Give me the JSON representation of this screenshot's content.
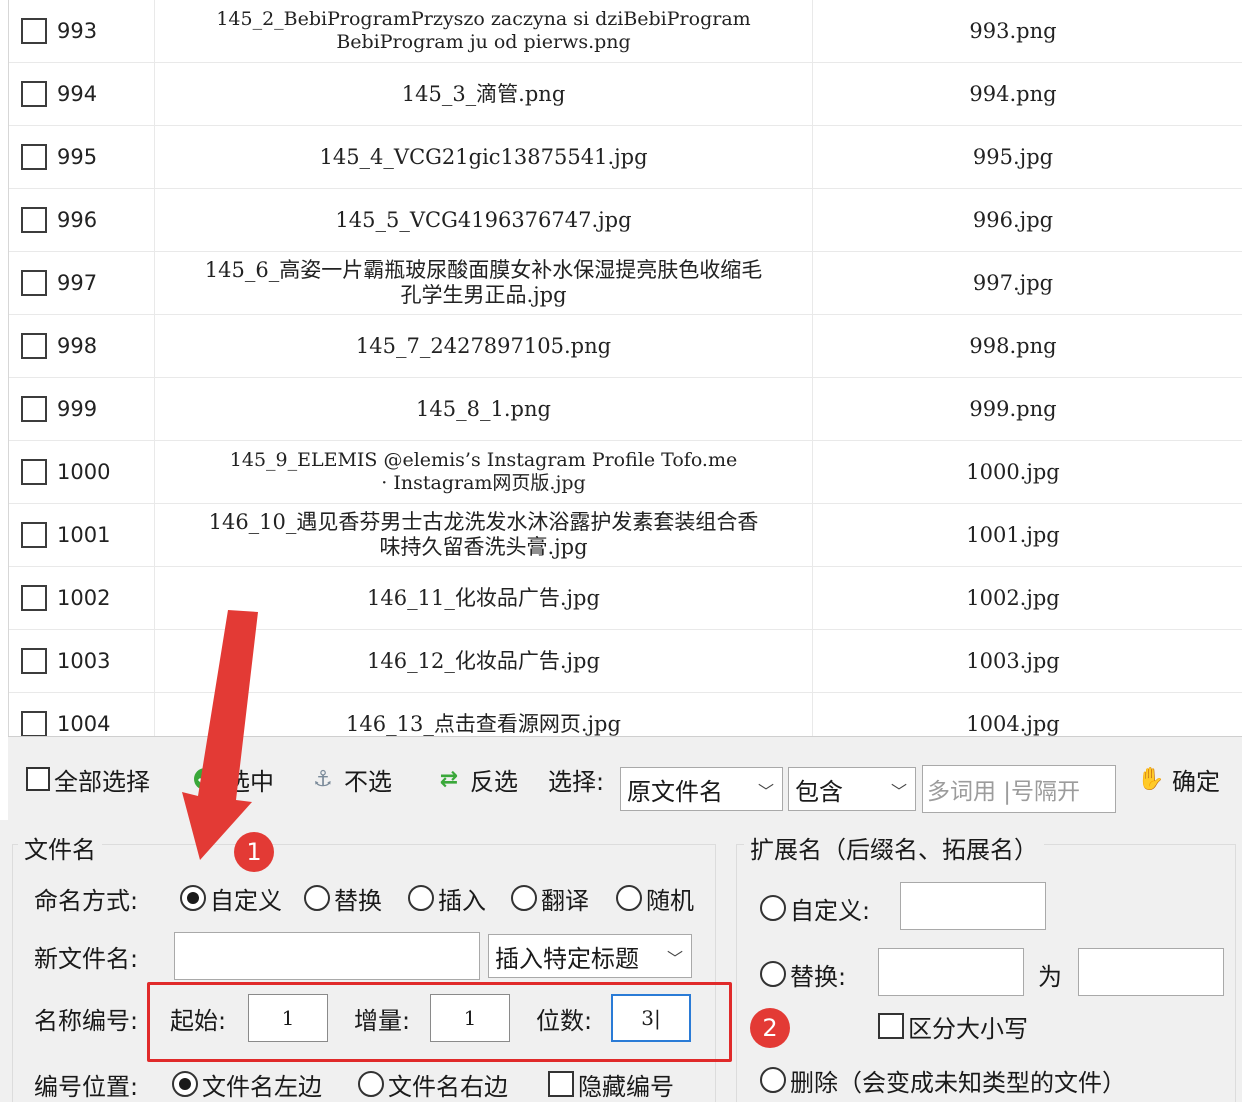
{
  "table": {
    "rows": [
      {
        "num": "993",
        "orig_line1": "145_2_BebiProgramPrzyszo zaczyna si dziBebiProgram",
        "orig_line2": "BebiProgram ju od pierws.png",
        "new": "993.png"
      },
      {
        "num": "994",
        "orig_line1": "145_3_滴管.png",
        "orig_line2": "",
        "new": "994.png"
      },
      {
        "num": "995",
        "orig_line1": "145_4_VCG21gic13875541.jpg",
        "orig_line2": "",
        "new": "995.jpg"
      },
      {
        "num": "996",
        "orig_line1": "145_5_VCG4196376747.jpg",
        "orig_line2": "",
        "new": "996.jpg"
      },
      {
        "num": "997",
        "orig_line1": "145_6_高姿一片霸瓶玻尿酸面膜女补水保湿提亮肤色收缩毛",
        "orig_line2": "孔学生男正品.jpg",
        "new": "997.jpg"
      },
      {
        "num": "998",
        "orig_line1": "145_7_2427897105.png",
        "orig_line2": "",
        "new": "998.png"
      },
      {
        "num": "999",
        "orig_line1": "145_8_1.png",
        "orig_line2": "",
        "new": "999.png"
      },
      {
        "num": "1000",
        "orig_line1": "145_9_ELEMIS  @elemis’s Instagram Profile  Tofo.me",
        "orig_line2": "· Instagram网页版.jpg",
        "new": "1000.jpg"
      },
      {
        "num": "1001",
        "orig_line1": "146_10_遇见香芬男士古龙洗发水沐浴露护发素套装组合香",
        "orig_line2": "味持久留香洗头膏.jpg",
        "new": "1001.jpg"
      },
      {
        "num": "1002",
        "orig_line1": "146_11_化妆品广告.jpg",
        "orig_line2": "",
        "new": "1002.jpg"
      },
      {
        "num": "1003",
        "orig_line1": "146_12_化妆品广告.jpg",
        "orig_line2": "",
        "new": "1003.jpg"
      },
      {
        "num": "1004",
        "orig_line1": "146_13_点击查看源网页.jpg",
        "orig_line2": "",
        "new": "1004.jpg"
      }
    ]
  },
  "toolbar": {
    "select_all": "全部选择",
    "select": "选中",
    "deselect": "不选",
    "invert": "反选",
    "choose_label": "选择:",
    "field_dropdown": "原文件名",
    "match_dropdown": "包含",
    "keyword_placeholder": "多词用 |号隔开",
    "confirm": "确定"
  },
  "filename": {
    "legend": "文件名",
    "mode_label": "命名方式:",
    "modes": [
      "自定义",
      "替换",
      "插入",
      "翻译",
      "随机"
    ],
    "new_name_label": "新文件名:",
    "new_name_value": "",
    "insert_title_dropdown": "插入特定标题",
    "numbering_label": "名称编号:",
    "start_label": "起始:",
    "start_value": "1",
    "step_label": "增量:",
    "step_value": "1",
    "digits_label": "位数:",
    "digits_value": "3",
    "position_label": "编号位置:",
    "position_left": "文件名左边",
    "position_right": "文件名右边",
    "hide_number": "隐藏编号"
  },
  "extension": {
    "legend": "扩展名（后缀名、拓展名）",
    "custom": "自定义:",
    "replace": "替换:",
    "to": "为",
    "case_sensitive": "区分大小写",
    "delete": "删除（会变成未知类型的文件）"
  },
  "annotations": {
    "badge1": "1",
    "badge2": "2",
    "accent_red": "#e33a35"
  }
}
